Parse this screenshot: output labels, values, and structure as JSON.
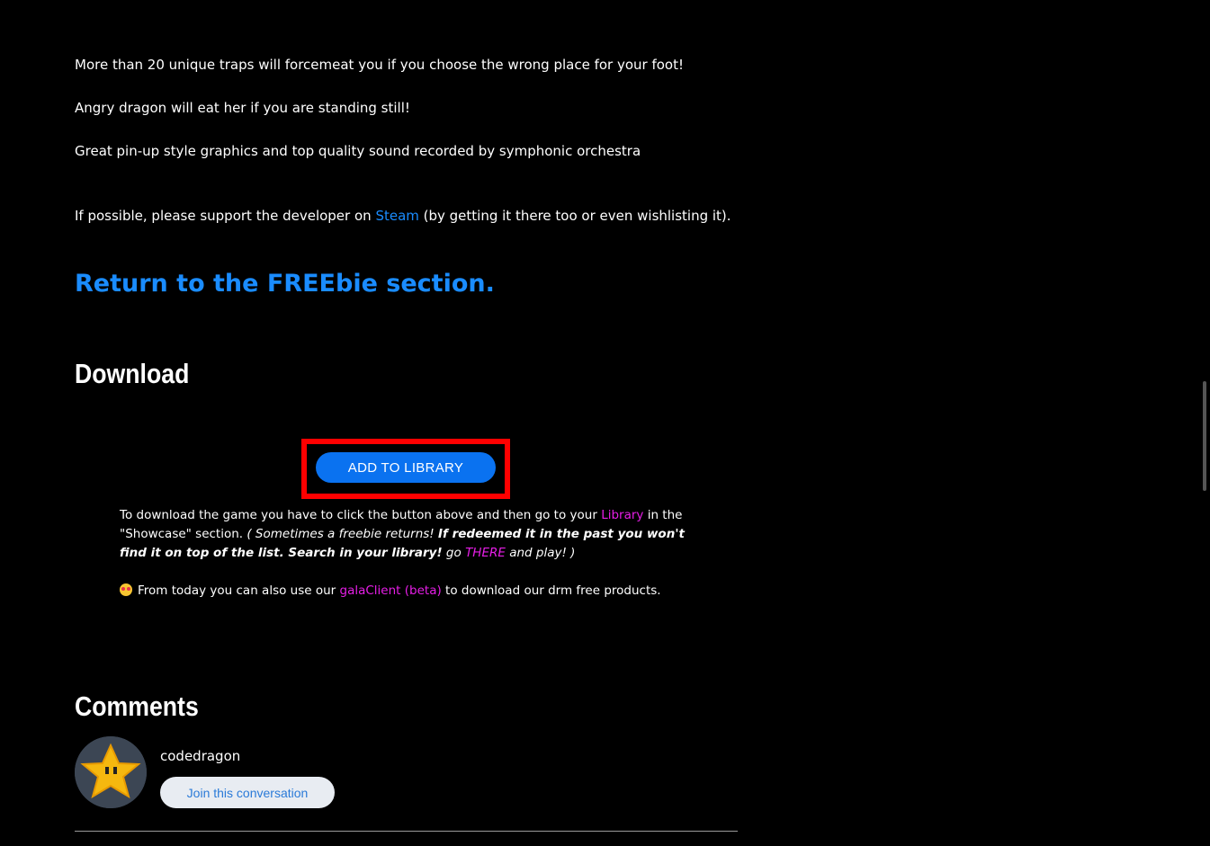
{
  "description": {
    "line1": "More than 20 unique traps will forcemeat you if you choose the wrong place for your foot!",
    "line2": "Angry dragon will eat her if you are standing still!",
    "line3": "Great pin-up style graphics and top quality sound recorded by symphonic orchestra",
    "support_before": "If possible, please support the developer on ",
    "support_link": "Steam",
    "support_after": " (by getting it there too or even wishlisting it)."
  },
  "return_link": "Return to the FREEbie section.",
  "download": {
    "heading": "Download",
    "button_label": "ADD TO LIBRARY",
    "info_before": "To download the game you have to click the button above and then go to your ",
    "info_library_link": "Library",
    "info_after_library": " in the \"Showcase\" section. ",
    "info_italic": "( Sometimes a freebie returns! ",
    "info_bold_italic": "If redeemed it in the past you won't find it on top of the list. Search in your library!",
    "info_go": " go ",
    "info_there_link": "THERE",
    "info_end": " and play! )",
    "gala_before": "From today you can also use our ",
    "gala_link": "galaClient (beta)",
    "gala_after": " to download our drm free products."
  },
  "comments": {
    "heading": "Comments",
    "username": "codedragon",
    "join_button": "Join this conversation"
  },
  "colors": {
    "background": "#000000",
    "link_blue": "#1a8cff",
    "link_magenta": "#e61ee6",
    "button_blue": "#0a72f0",
    "highlight_red": "#ff0000"
  }
}
